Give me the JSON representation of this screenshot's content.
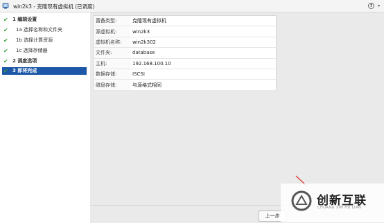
{
  "window": {
    "title": "win2k3 - 克隆现有虚拟机 (已调度)",
    "help_glyph": "?",
    "expand_glyph": "»"
  },
  "steps": [
    {
      "label": "1  编辑设置",
      "completed": true,
      "level": "main"
    },
    {
      "label": "1a  选择名称和文件夹",
      "completed": true,
      "level": "sub"
    },
    {
      "label": "1b  选择计算资源",
      "completed": true,
      "level": "sub"
    },
    {
      "label": "1c  选择存储器",
      "completed": true,
      "level": "sub"
    },
    {
      "label": "2  调度选项",
      "completed": true,
      "level": "main"
    },
    {
      "label": "3  即将完成",
      "completed": true,
      "level": "main",
      "active": true
    }
  ],
  "summary": [
    {
      "key": "置备类型:",
      "value": "克隆现有虚拟机"
    },
    {
      "key": "源虚拟机:",
      "value": "win2k3"
    },
    {
      "key": "虚拟机名称:",
      "value": "win2k302"
    },
    {
      "key": "文件夹:",
      "value": "database"
    },
    {
      "key": "主机:",
      "value": "192.168.100.10"
    },
    {
      "key": "数据存储:",
      "value": "ISCSI"
    },
    {
      "key": "磁盘存储:",
      "value": "与源格式相同"
    }
  ],
  "footer": {
    "back_label": "上一步"
  },
  "watermark": {
    "cn": "创新互联",
    "en": "CHUANG XIN HU LIAN"
  },
  "colors": {
    "active_step": "#1d57a8",
    "check": "#3a9f3a",
    "content_bg": "#eaeaea"
  },
  "icons": {
    "app": "vm-icon",
    "check": "checkmark-icon"
  }
}
